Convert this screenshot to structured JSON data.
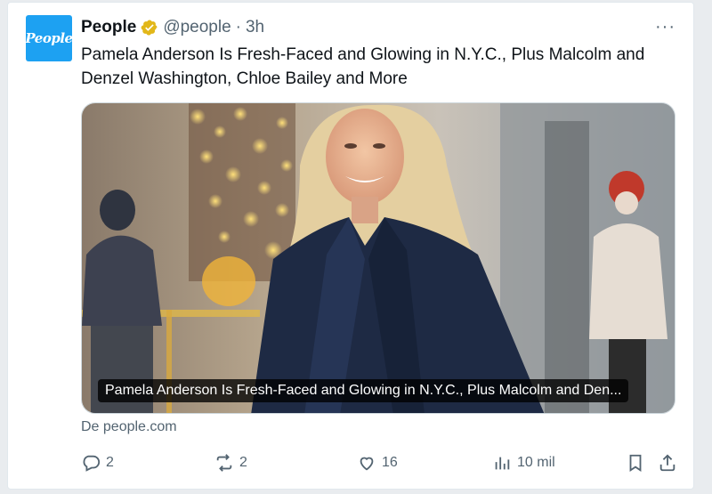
{
  "tweet": {
    "author_name": "People",
    "handle": "@people",
    "separator": "·",
    "time": "3h",
    "avatar_text": "People",
    "text": "Pamela Anderson Is Fresh-Faced and Glowing in N.Y.C., Plus Malcolm and Denzel Washington, Chloe Bailey and More",
    "more_label": "···"
  },
  "card": {
    "caption": "Pamela Anderson Is Fresh-Faced and Glowing in N.Y.C., Plus Malcolm and Den...",
    "source": "De people.com"
  },
  "actions": {
    "replies": "2",
    "reposts": "2",
    "likes": "16",
    "views": "10 mil"
  },
  "colors": {
    "brand": "#1da1f2",
    "verified": "#e2b719",
    "muted": "#536471"
  }
}
